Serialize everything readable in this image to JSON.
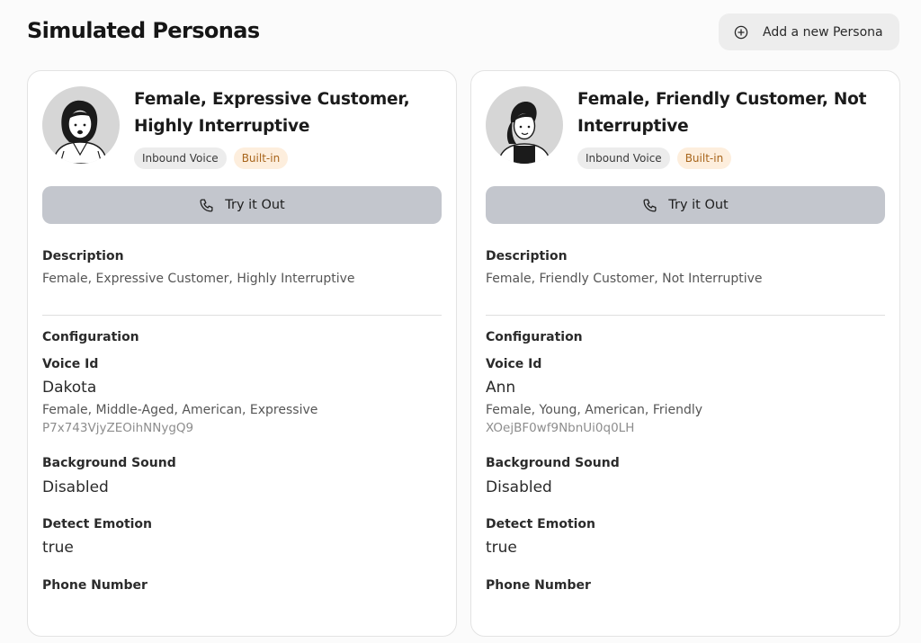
{
  "header": {
    "title": "Simulated Personas",
    "add_button_label": "Add a new Persona",
    "add_button_icon": "plus-circle-icon"
  },
  "personas": [
    {
      "name": "Female, Expressive Customer, Highly Interruptive",
      "badges": [
        "Inbound Voice",
        "Built-in"
      ],
      "try_label": "Try it Out",
      "description_label": "Description",
      "description": "Female, Expressive Customer, Highly Interruptive",
      "configuration_label": "Configuration",
      "voice_id_label": "Voice Id",
      "voice_name": "Dakota",
      "voice_traits": "Female, Middle-Aged, American, Expressive",
      "voice_id": "P7x743VjyZEOihNNygQ9",
      "background_sound_label": "Background Sound",
      "background_sound": "Disabled",
      "detect_emotion_label": "Detect Emotion",
      "detect_emotion": "true",
      "phone_number_label": "Phone Number"
    },
    {
      "name": "Female, Friendly Customer, Not Interruptive",
      "badges": [
        "Inbound Voice",
        "Built-in"
      ],
      "try_label": "Try it Out",
      "description_label": "Description",
      "description": "Female, Friendly Customer, Not Interruptive",
      "configuration_label": "Configuration",
      "voice_id_label": "Voice Id",
      "voice_name": "Ann",
      "voice_traits": "Female, Young, American, Friendly",
      "voice_id": "XOejBF0wf9NbnUi0q0LH",
      "background_sound_label": "Background Sound",
      "background_sound": "Disabled",
      "detect_emotion_label": "Detect Emotion",
      "detect_emotion": "true",
      "phone_number_label": "Phone Number"
    }
  ],
  "colors": {
    "button_gray": "#c3c6cd",
    "badge_orange_bg": "#fdeedd",
    "badge_orange_text": "#a8651c"
  }
}
